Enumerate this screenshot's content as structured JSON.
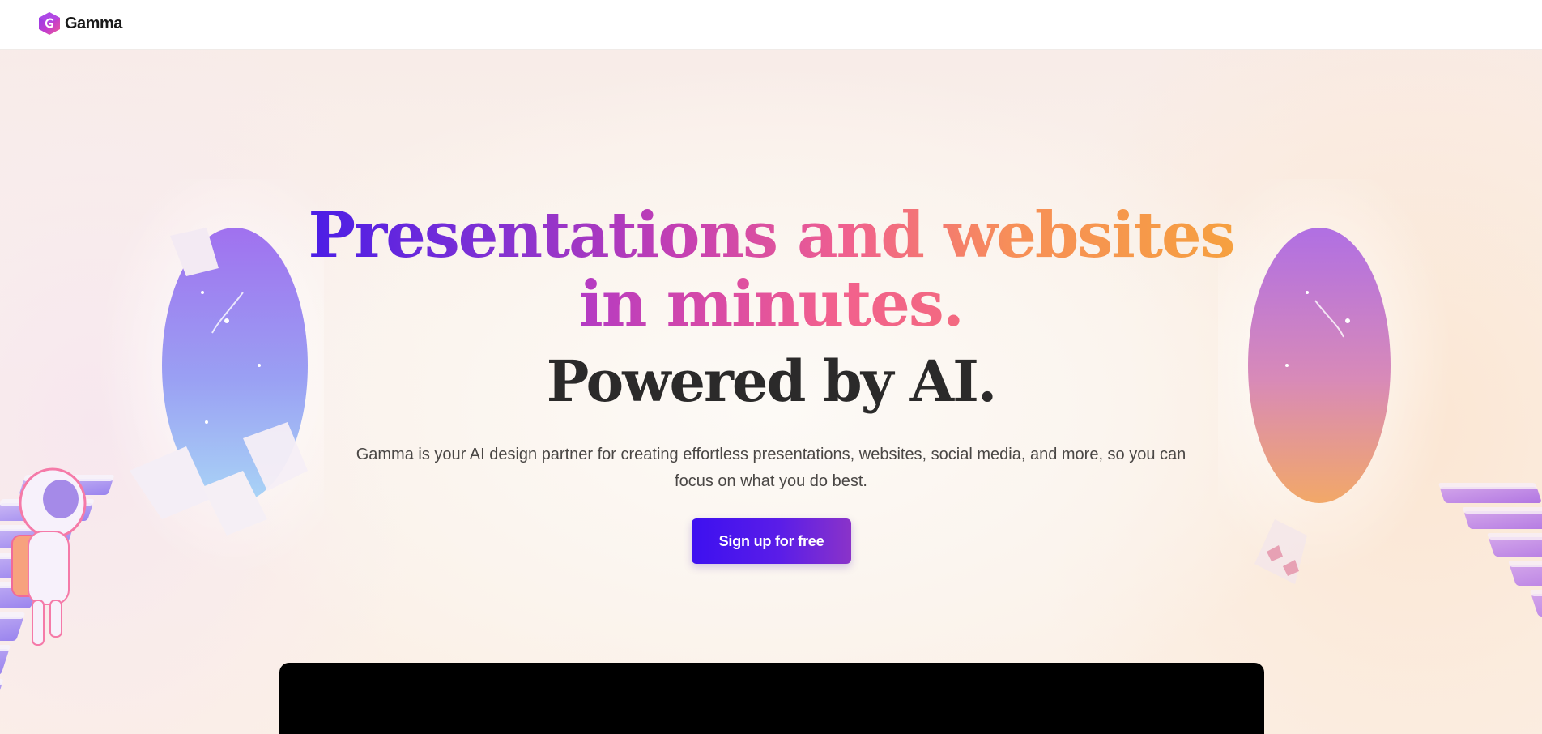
{
  "header": {
    "logo_text": "Gamma",
    "logo_icon": "gamma-logo-icon",
    "logo_colors": [
      "#6a2ee8",
      "#c13ccf",
      "#f05a95"
    ]
  },
  "hero": {
    "headline_line1": "Presentations and websites",
    "headline_line2": "in minutes.",
    "subheadline": "Powered by AI.",
    "description": "Gamma is your AI design partner for creating effortless presentations, websites, social media, and more, so you can focus on what you do best.",
    "cta_label": "Sign up for free",
    "colors": {
      "cta_start": "#3d10f0",
      "cta_end": "#8a33c9",
      "headline_gradient": [
        "#4a1de6",
        "#c43fb3",
        "#f0608f",
        "#f6a040"
      ]
    }
  },
  "media": {
    "video_panel_icon": "video-preview"
  }
}
